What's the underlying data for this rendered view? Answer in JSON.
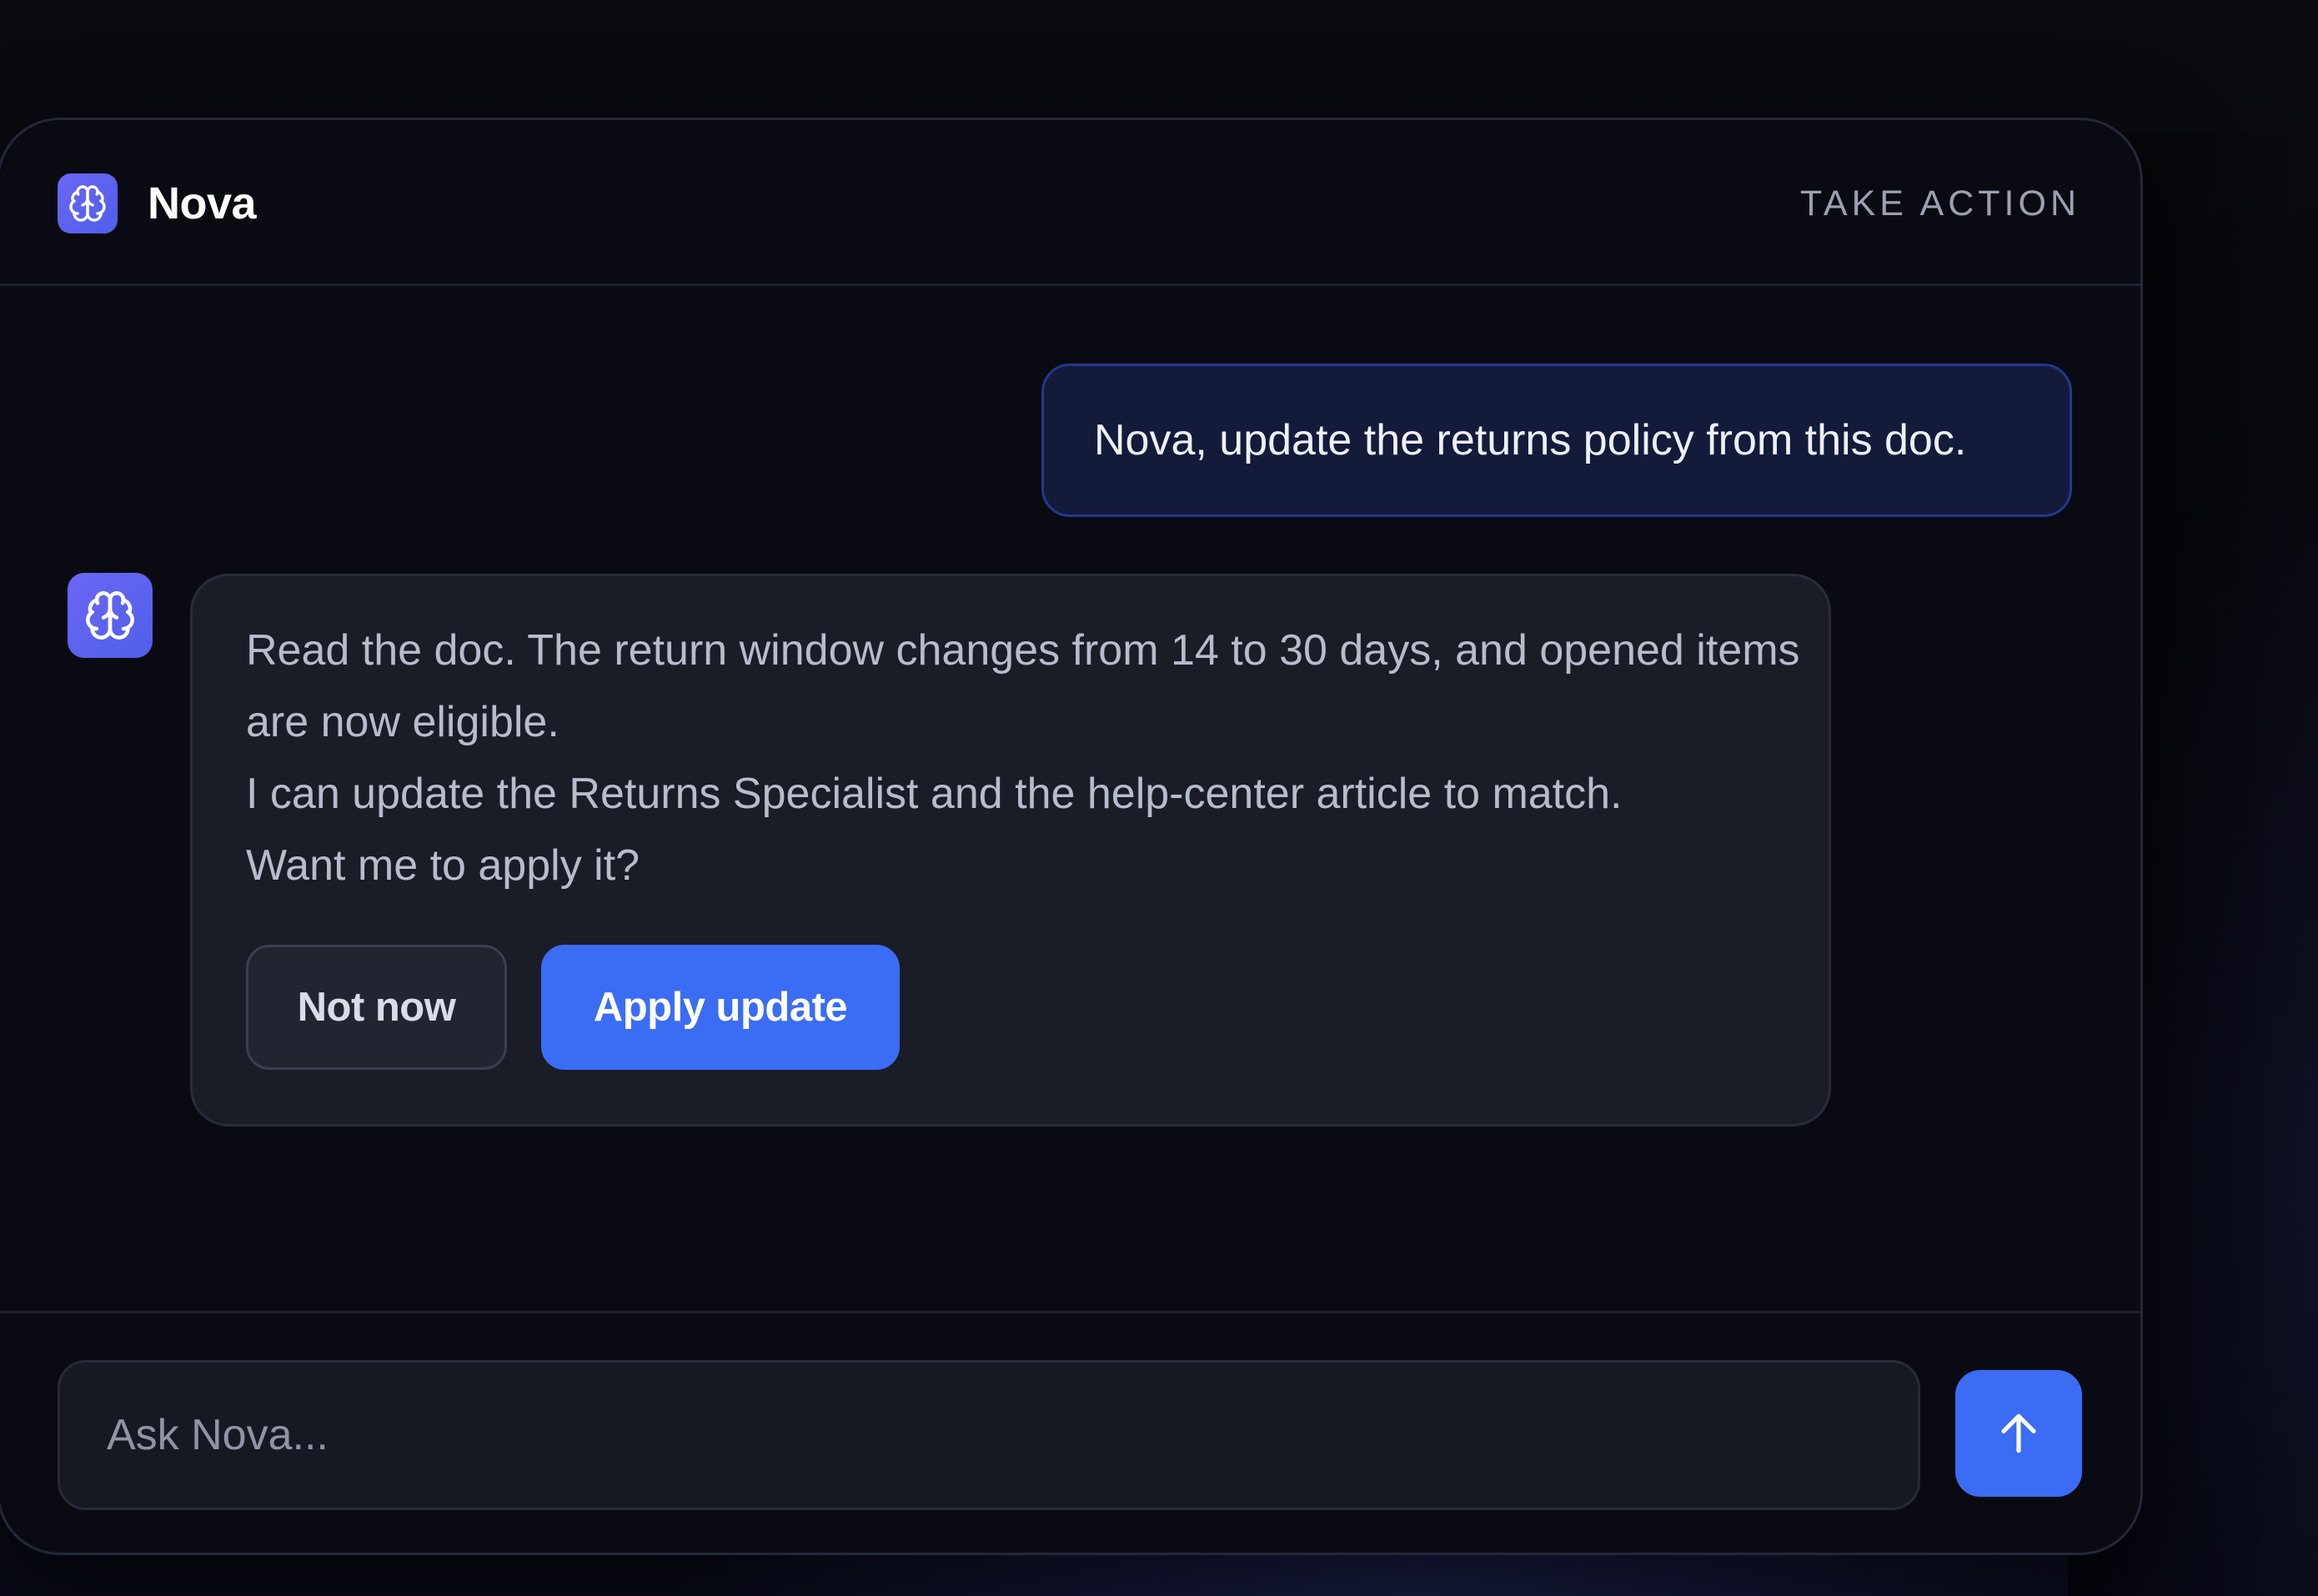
{
  "app": {
    "name": "Nova",
    "header_action": "TAKE ACTION",
    "brand_icon": "brain-icon"
  },
  "conversation": {
    "user_message": "Nova, update the returns policy from this doc.",
    "bot_avatar_icon": "brain-icon",
    "bot_message_lines": [
      "Read the doc. The return window changes from 14 to 30 days, and opened items are now eligible.",
      "I can update the Returns Specialist and the help-center article to match.",
      "Want me to apply it?"
    ],
    "actions": {
      "secondary_label": "Not now",
      "primary_label": "Apply update"
    }
  },
  "composer": {
    "placeholder": "Ask Nova...",
    "value": "",
    "send_icon": "arrow-up-icon"
  },
  "colors": {
    "accent": "#3b6cf4",
    "brand_gradient_start": "#6b66f5",
    "brand_gradient_end": "#4f5fe9",
    "panel_background": "#0a0b12",
    "user_bubble": "#141a3a",
    "bot_bubble": "#1a1c26"
  }
}
